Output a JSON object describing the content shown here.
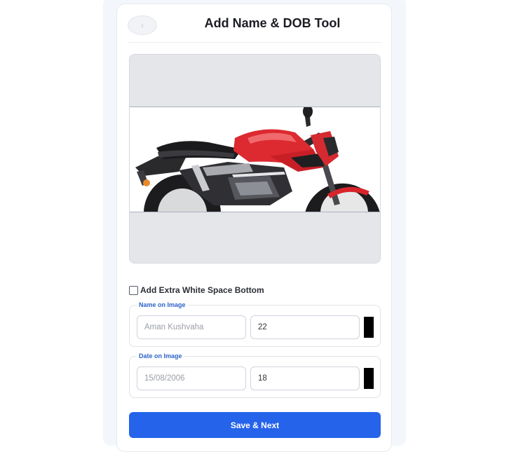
{
  "header": {
    "title": "Add Name & DOB Tool",
    "back_icon": "chevron-left-icon"
  },
  "preview": {
    "image": "red-motorcycle-photo"
  },
  "options": {
    "extra_space_label": "Add Extra White Space Bottom",
    "extra_space_checked": false
  },
  "name_section": {
    "legend": "Name on Image",
    "placeholder": "Aman Kushvaha",
    "value": "",
    "size_value": "22",
    "color": "#000000"
  },
  "date_section": {
    "legend": "Date on Image",
    "placeholder": "15/08/2006",
    "value": "",
    "size_value": "18",
    "color": "#000000"
  },
  "actions": {
    "save_label": "Save & Next",
    "primary_color": "#2563eb"
  }
}
